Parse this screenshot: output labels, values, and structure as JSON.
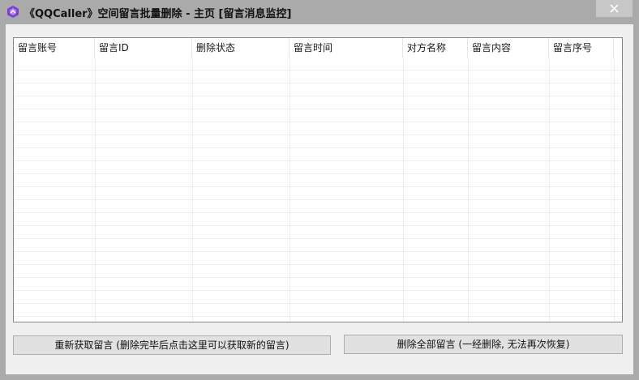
{
  "window": {
    "title": "《QQCaller》空间留言批量删除 - 主页 [留言消息监控]",
    "icon": "purple-hexagon-app-icon",
    "accent": "#7b3fd6"
  },
  "listview": {
    "columns": [
      {
        "label": "留言账号"
      },
      {
        "label": "留言ID"
      },
      {
        "label": "删除状态"
      },
      {
        "label": "留言时间"
      },
      {
        "label": "对方名称"
      },
      {
        "label": "留言内容"
      },
      {
        "label": "留言序号"
      }
    ],
    "rows": []
  },
  "buttons": {
    "refetch_label": "重新获取留言 (删除完毕后点击这里可以获取新的留言)",
    "delete_all_label": "删除全部留言 (一经删除, 无法再次恢复)"
  }
}
